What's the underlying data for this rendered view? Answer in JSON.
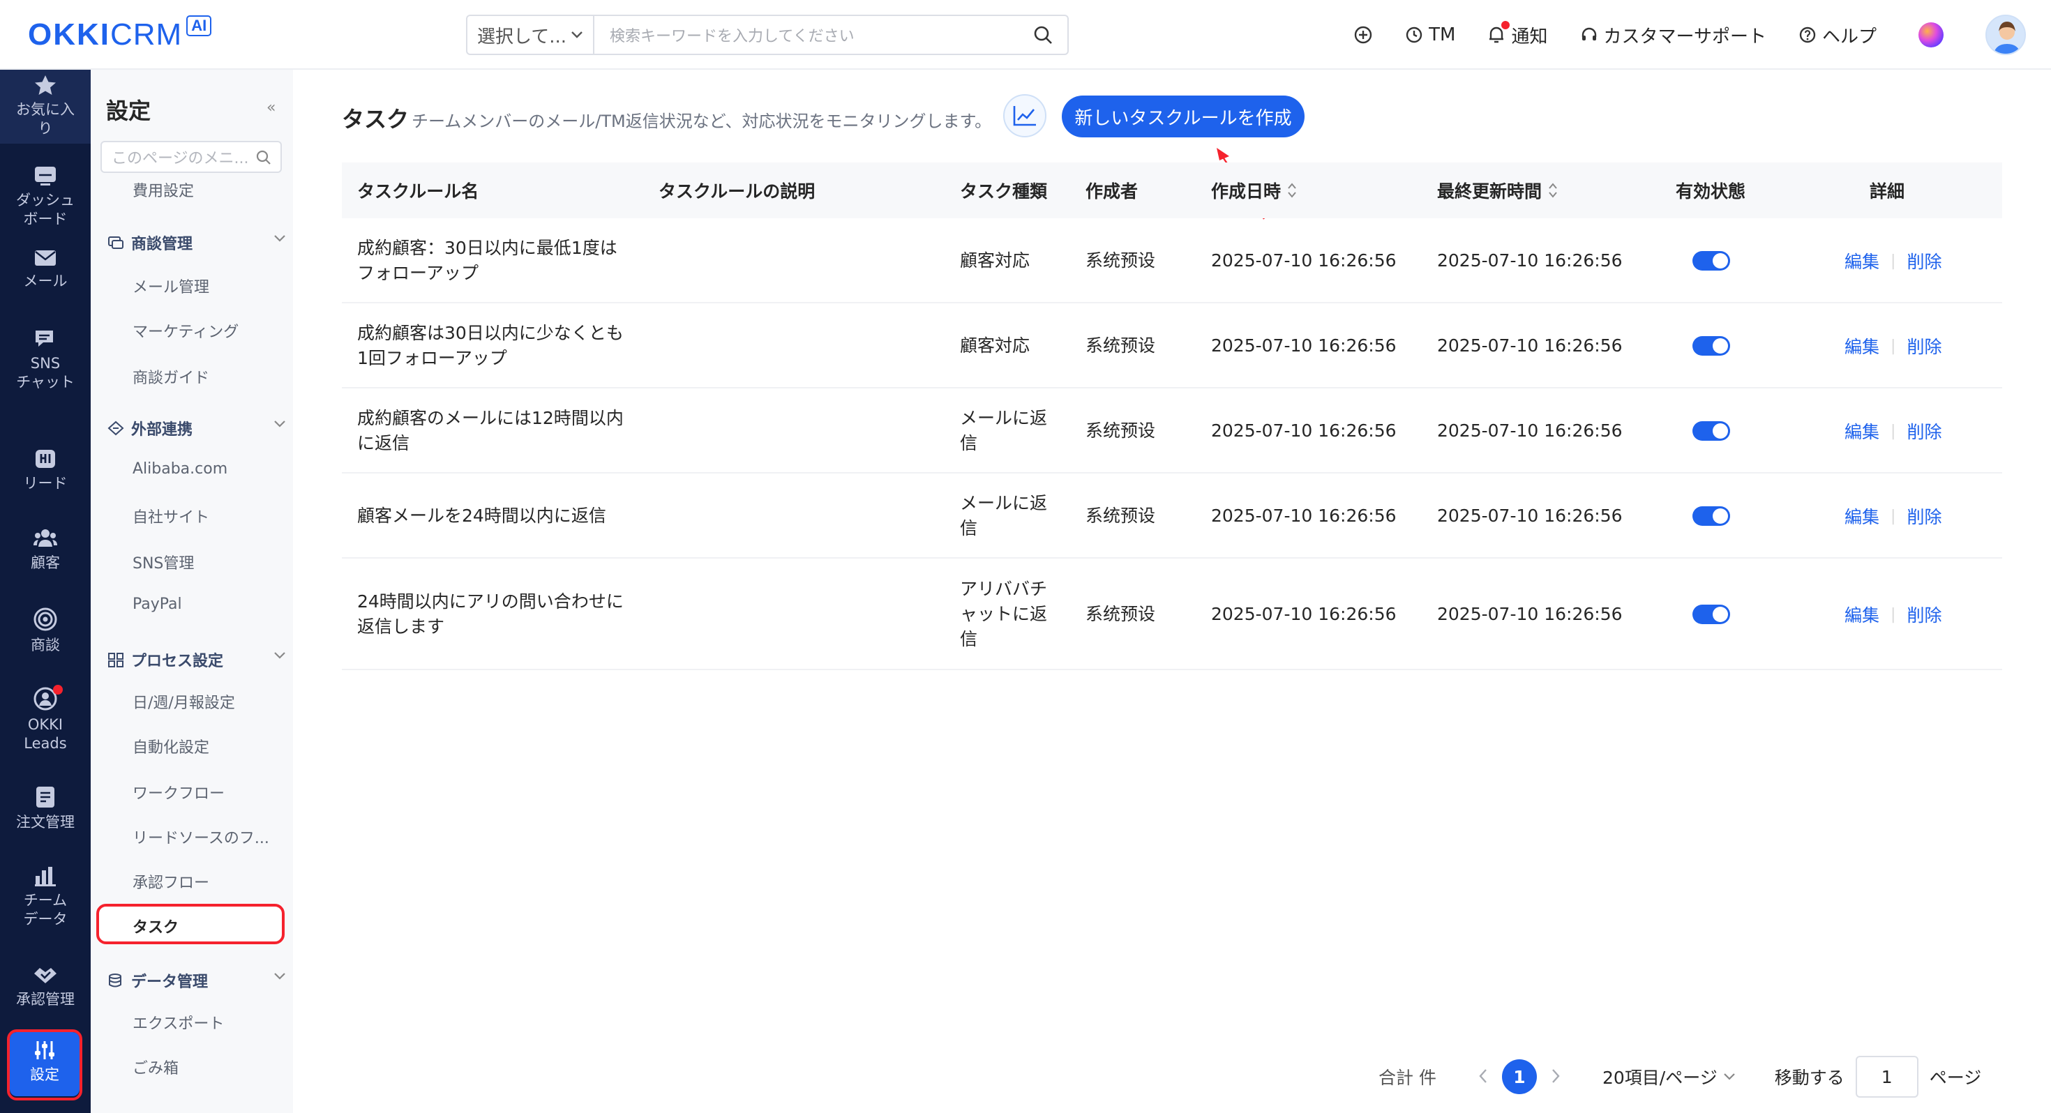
{
  "header": {
    "logo_main": "OKKI",
    "logo_crm": "CRM",
    "logo_ai": "AI",
    "search_select": "選択して...",
    "search_placeholder": "検索キーワードを入力してください",
    "actions": {
      "tm": "TM",
      "notify": "通知",
      "support": "カスタマーサポート",
      "help": "ヘルプ"
    }
  },
  "rail": {
    "items": [
      {
        "label": "お気に入\nり",
        "icon": "star-icon"
      },
      {
        "label": "ダッシュ\nボード",
        "icon": "dashboard-icon"
      },
      {
        "label": "メール",
        "icon": "mail-icon"
      },
      {
        "label": "SNS\nチャット",
        "icon": "chat-icon"
      },
      {
        "label": "リード",
        "icon": "lead-icon"
      },
      {
        "label": "顧客",
        "icon": "customer-icon"
      },
      {
        "label": "商談",
        "icon": "target-icon"
      },
      {
        "label": "OKKI\nLeads",
        "icon": "okki-leads-icon"
      },
      {
        "label": "注文管理",
        "icon": "order-icon"
      },
      {
        "label": "チーム\nデータ",
        "icon": "team-data-icon"
      },
      {
        "label": "承認管理",
        "icon": "approval-icon"
      },
      {
        "label": "設定",
        "icon": "settings-icon"
      }
    ]
  },
  "submenu": {
    "title": "設定",
    "collapse": "«",
    "search_placeholder": "このページのメニ...",
    "cost": "費用設定",
    "groups": {
      "deal": "商談管理",
      "external": "外部連携",
      "process": "プロセス設定",
      "data": "データ管理"
    },
    "deal_items": [
      "メール管理",
      "マーケティング",
      "商談ガイド"
    ],
    "external_items": [
      "Alibaba.com",
      "自社サイト",
      "SNS管理",
      "PayPal"
    ],
    "process_items": [
      "日/週/月報設定",
      "自動化設定",
      "ワークフロー",
      "リードソースのフ...",
      "承認フロー"
    ],
    "active": "タスク",
    "data_items": [
      "エクスポート",
      "ごみ箱"
    ]
  },
  "page": {
    "title": "タスク",
    "subtitle": "チームメンバーのメール/TM返信状況など、対応状況をモニタリングします。",
    "create_button": "新しいタスクルールを作成"
  },
  "table": {
    "headers": {
      "name": "タスクルール名",
      "desc": "タスクルールの説明",
      "type": "タスク種類",
      "creator": "作成者",
      "created": "作成日時",
      "updated": "最終更新時間",
      "status": "有効状態",
      "detail": "詳細"
    },
    "rows": [
      {
        "name": "成約顧客：30日以内に最低1度は\nフォローアップ",
        "type": "顧客対応",
        "creator": "系统预设",
        "created": "2025-07-10 16:26:56",
        "updated": "2025-07-10 16:26:56",
        "enabled": true
      },
      {
        "name": "成約顧客は30日以内に少なくとも\n1回フォローアップ",
        "type": "顧客対応",
        "creator": "系统预设",
        "created": "2025-07-10 16:26:56",
        "updated": "2025-07-10 16:26:56",
        "enabled": true
      },
      {
        "name": "成約顧客のメールには12時間以内\nに返信",
        "type": "メールに返\n信",
        "creator": "系统预设",
        "created": "2025-07-10 16:26:56",
        "updated": "2025-07-10 16:26:56",
        "enabled": true
      },
      {
        "name": "顧客メールを24時間以内に返信",
        "type": "メールに返\n信",
        "creator": "系统预设",
        "created": "2025-07-10 16:26:56",
        "updated": "2025-07-10 16:26:56",
        "enabled": true
      },
      {
        "name": "24時間以内にアリの問い合わせに\n返信します",
        "type": "アリババチ\nャットに返\n信",
        "creator": "系统预设",
        "created": "2025-07-10 16:26:56",
        "updated": "2025-07-10 16:26:56",
        "enabled": true
      }
    ],
    "edit_label": "編集",
    "delete_label": "削除"
  },
  "pagination": {
    "total": "合計 件",
    "current_page": "1",
    "page_size": "20項目/ページ",
    "jump_label": "移動する",
    "jump_value": "1",
    "page_suffix": "ページ"
  },
  "colors": {
    "primary": "#1e62ec",
    "rail_bg": "#0e1b3d",
    "annotation": "#f5222d"
  }
}
